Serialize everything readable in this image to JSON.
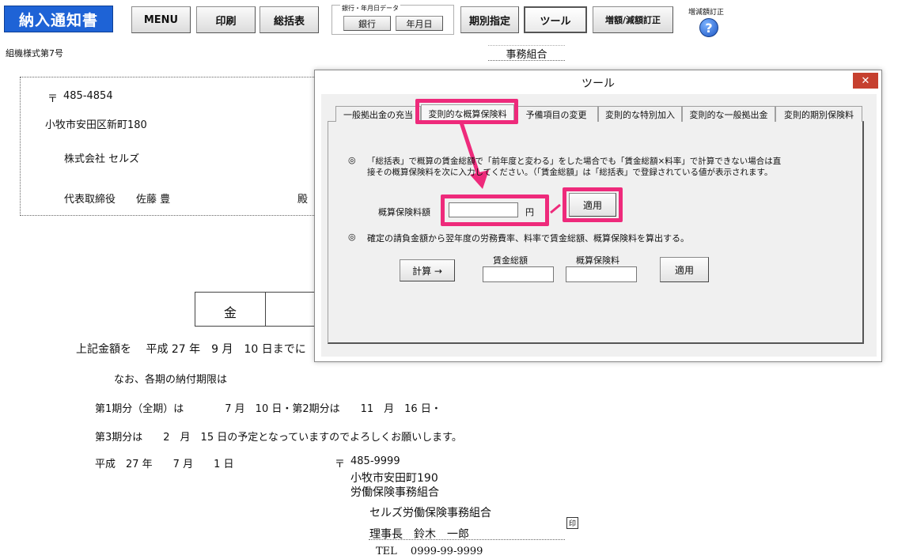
{
  "toolbar": {
    "title": "納入通知書",
    "menu": "MENU",
    "print": "印刷",
    "summary": "総括表",
    "bank_group_label": "銀行・年月日データ",
    "bank": "銀行",
    "date": "年月日",
    "period": "期別指定",
    "tool": "ツール",
    "increase": "増額/減額訂正",
    "increase_small": "増減額訂正",
    "help_glyph": "?"
  },
  "document": {
    "form_no": "組機様式第7号",
    "office_label": "事務組合",
    "postal_mark": "〒",
    "postal_code": "485-4854",
    "address": "小牧市安田区新町180",
    "company": "株式会社 セルズ",
    "rep_title": "代表取締役",
    "rep_name": "佐藤 豊",
    "honorific": "殿",
    "amount_label": "金",
    "line1": "上記金額を　 平成 27 年　9 月　10 日までに",
    "line2": "なお、各期の納付期限は",
    "line3": "第1期分（全期）は　　　　7 月　10 日・第2期分は　　11　月　16 日・",
    "line4": "第3期分は　　2　月　15 日の予定となっていますのでよろしくお願いします。",
    "date_line": "平成　27 年　　7 月　　1 日",
    "sender_postal_mark": "〒",
    "sender_postal": "485-9999",
    "sender_address": "小牧市安田町190",
    "sender_org": "労働保険事務組合",
    "sender_name": "セルズ労働保険事務組合",
    "director": "理事長　鈴木　一郎",
    "stamp": "印",
    "tel": "TEL　 0999-99-9999"
  },
  "dialog": {
    "title": "ツール",
    "close": "✕",
    "tabs": [
      {
        "label": "一般拠出金の充当"
      },
      {
        "label": "変則的な概算保険料"
      },
      {
        "label": "予備項目の変更"
      },
      {
        "label": "変則的な特別加入"
      },
      {
        "label": "変則的な一般拠出金"
      },
      {
        "label": "変則的期別保険料"
      }
    ],
    "bullet": "◎",
    "note1a": "「総括表」で概算の賃金総額で「前年度と変わる」をした場合でも「賃金総額×料率」で計算できない場合は直",
    "note1b": "接その概算保険料を次に入力してください。（「賃金総額」は「総括表」で登録されている値が表示されます。",
    "premium_label": "概算保険料額",
    "premium_value": "",
    "yen": "円",
    "apply1": "適用",
    "note2": "確定の請負金額から翌年度の労務費率、料率で賃金総額、概算保険料を算出する。",
    "calc_button": "計算 →",
    "wage_total_label": "賃金総額",
    "premium2_label": "概算保険料",
    "wage_total_value": "",
    "premium2_value": "",
    "apply2": "適用",
    "highlight_color": "#ee2a7b"
  }
}
